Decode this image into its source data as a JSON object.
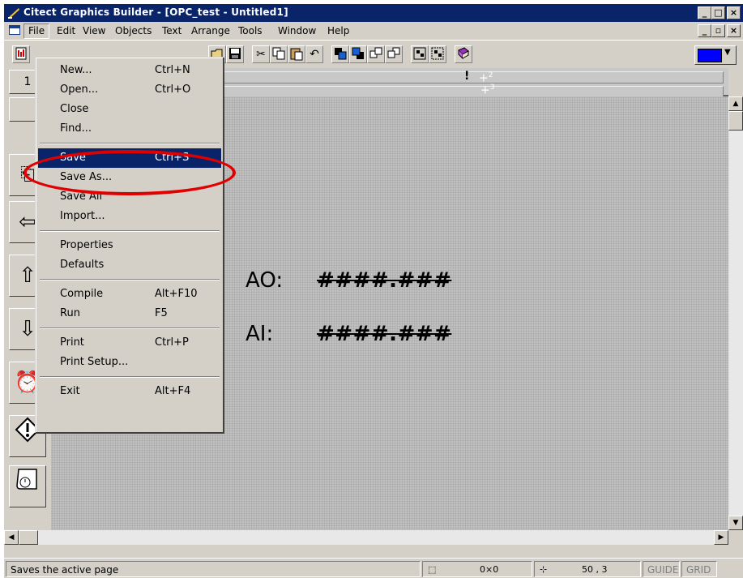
{
  "window": {
    "title": "Citect Graphics Builder - [OPC_test - Untitled1]",
    "controls": {
      "minimize": "_",
      "maximize": "□",
      "close": "×"
    },
    "doc_controls": {
      "minimize": "_",
      "restore": "▫",
      "close": "×"
    }
  },
  "menubar": {
    "items": [
      "File",
      "Edit",
      "View",
      "Objects",
      "Text",
      "Arrange",
      "Tools",
      "Window",
      "Help"
    ]
  },
  "file_menu": {
    "items": [
      {
        "label": "New...",
        "shortcut": "Ctrl+N"
      },
      {
        "label": "Open...",
        "shortcut": "Ctrl+O"
      },
      {
        "label": "Close",
        "shortcut": ""
      },
      {
        "label": "Find...",
        "shortcut": ""
      },
      {
        "label": "Save",
        "shortcut": "Ctrl+S",
        "highlighted": true
      },
      {
        "label": "Save As...",
        "shortcut": ""
      },
      {
        "label": "Save All",
        "shortcut": ""
      },
      {
        "label": "Import...",
        "shortcut": ""
      },
      {
        "label": "Properties",
        "shortcut": ""
      },
      {
        "label": "Defaults",
        "shortcut": ""
      },
      {
        "label": "Compile",
        "shortcut": "Alt+F10"
      },
      {
        "label": "Run",
        "shortcut": "F5"
      },
      {
        "label": "Print",
        "shortcut": "Ctrl+P"
      },
      {
        "label": "Print Setup...",
        "shortcut": ""
      },
      {
        "label": "Exit",
        "shortcut": "Alt+F4"
      }
    ]
  },
  "canvas": {
    "ao_label": "AO:",
    "ao_value": "####.###",
    "ai_label": "AI:",
    "ai_value": "####.###",
    "field_marker": "!",
    "field_sup_2": "2",
    "field_sup_3": "3"
  },
  "statusbar": {
    "message": "Saves the active page",
    "size": "0×0",
    "position": "50 , 3",
    "guide": "GUIDE",
    "grid": "GRID"
  },
  "colors": {
    "title_bg": "#0a246a",
    "highlight": "#0a246a",
    "annotation_circle": "#e00000",
    "fill_color": "#0000ff"
  }
}
